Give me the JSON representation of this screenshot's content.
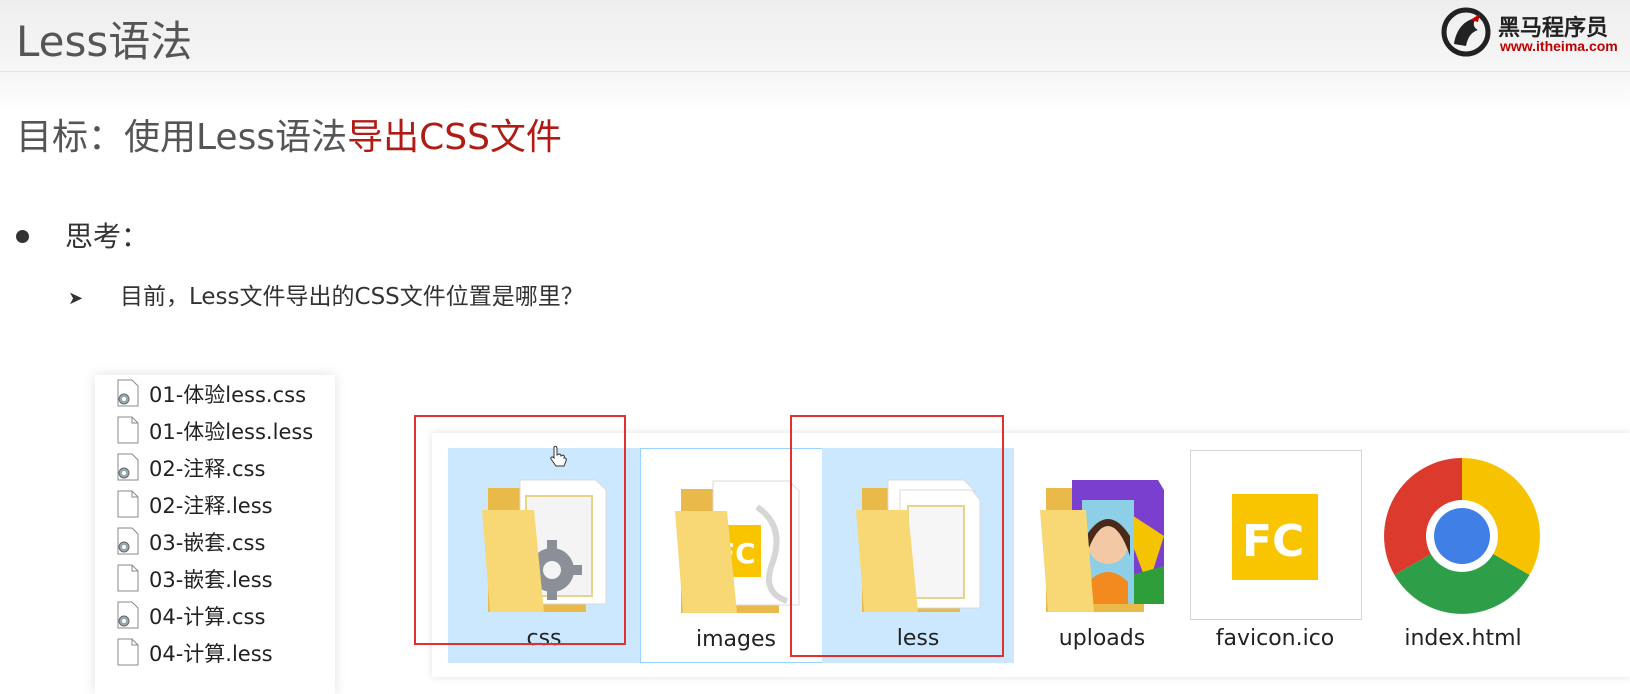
{
  "header": {
    "title": "Less语法",
    "logo_name": "黑马程序员",
    "logo_url": "www.itheima.com"
  },
  "goal": {
    "prefix": "目标：使用Less语法",
    "highlight": "导出CSS文件"
  },
  "bullet": {
    "text": "思考："
  },
  "sub_bullet": {
    "text": "目前，Less文件导出的CSS文件位置是哪里？"
  },
  "file_list": [
    {
      "name": "01-体验less.css",
      "icon": "css-file-gear-icon"
    },
    {
      "name": "01-体验less.less",
      "icon": "blank-file-icon"
    },
    {
      "name": "02-注释.css",
      "icon": "css-file-gear-icon"
    },
    {
      "name": "02-注释.less",
      "icon": "blank-file-icon"
    },
    {
      "name": "03-嵌套.css",
      "icon": "css-file-gear-icon"
    },
    {
      "name": "03-嵌套.less",
      "icon": "blank-file-icon"
    },
    {
      "name": "04-计算.css",
      "icon": "css-file-gear-icon"
    },
    {
      "name": "04-计算.less",
      "icon": "blank-file-icon"
    }
  ],
  "explorer_items": [
    {
      "name": "css",
      "icon": "folder-gear-icon",
      "state": "selected"
    },
    {
      "name": "images",
      "icon": "folder-fc-icon",
      "state": "hover"
    },
    {
      "name": "less",
      "icon": "folder-documents-icon",
      "state": "selected"
    },
    {
      "name": "uploads",
      "icon": "folder-photo-icon",
      "state": "normal"
    },
    {
      "name": "favicon.ico",
      "icon": "fc-logo-icon",
      "state": "normal"
    },
    {
      "name": "index.html",
      "icon": "chrome-icon",
      "state": "normal"
    }
  ],
  "colors": {
    "highlight": "#b01c14",
    "selection": "#cce8ff",
    "redbox": "#e03030",
    "folder": "#f8d775",
    "fc_yellow": "#f9c400"
  }
}
